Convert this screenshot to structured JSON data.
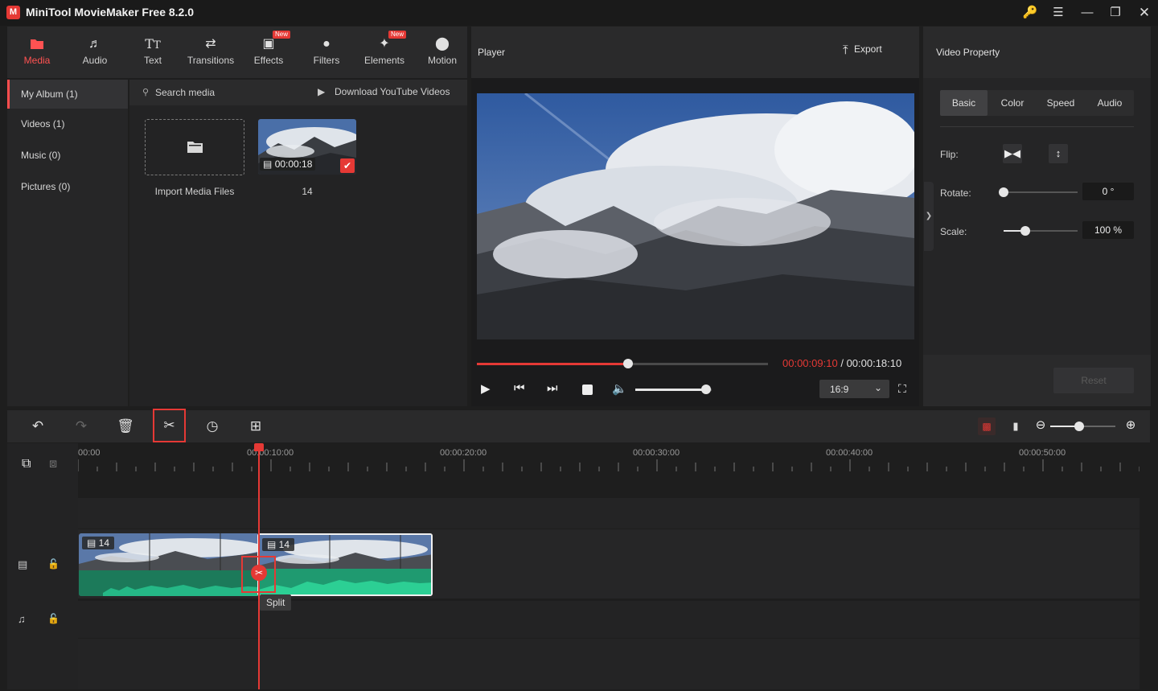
{
  "window": {
    "title": "MiniTool MovieMaker Free 8.2.0",
    "logo_text": "M"
  },
  "toolbar": {
    "tabs": [
      {
        "label": "Media",
        "icon": "media-folder-icon"
      },
      {
        "label": "Audio",
        "icon": "music-note-icon"
      },
      {
        "label": "Text",
        "icon": "text-tt-icon"
      },
      {
        "label": "Transitions",
        "icon": "swap-arrows-icon"
      },
      {
        "label": "Effects",
        "icon": "effects-icon",
        "badge": "New"
      },
      {
        "label": "Filters",
        "icon": "filters-icon"
      },
      {
        "label": "Elements",
        "icon": "elements-icon",
        "badge": "New"
      },
      {
        "label": "Motion",
        "icon": "motion-icon"
      }
    ]
  },
  "album": {
    "items": [
      {
        "label": "My Album (1)"
      },
      {
        "label": "Videos (1)"
      },
      {
        "label": "Music (0)"
      },
      {
        "label": "Pictures (0)"
      }
    ]
  },
  "media": {
    "search_placeholder": "Search media",
    "download_label": "Download YouTube Videos",
    "import_label": "Import Media Files",
    "clip_duration": "00:00:18",
    "clip_name": "14"
  },
  "player": {
    "title": "Player",
    "export_label": "Export",
    "current_time": "00:00:09:10",
    "separator": "/",
    "total_time": "00:00:18:10",
    "progress": 0.52,
    "volume": 0.93,
    "aspect_ratio": "16:9"
  },
  "property": {
    "title": "Video Property",
    "tabs": [
      "Basic",
      "Color",
      "Speed",
      "Audio"
    ],
    "flip_label": "Flip:",
    "rotate_label": "Rotate:",
    "rotate_value": "0 °",
    "rotate_level": 0.0,
    "scale_label": "Scale:",
    "scale_value": "100 %",
    "scale_level": 0.29,
    "reset_label": "Reset"
  },
  "timeline": {
    "ruler": [
      "00:00",
      "00:00:10:00",
      "00:00:20:00",
      "00:00:30:00",
      "00:00:40:00",
      "00:00:50:00"
    ],
    "clips": [
      {
        "label": "14"
      },
      {
        "label": "14"
      }
    ],
    "tooltip": "Split",
    "zoom_level": 0.45
  },
  "colors": {
    "accent": "#e53935",
    "audio_wave": "#22b37f",
    "bg": "#1e1e1e"
  }
}
